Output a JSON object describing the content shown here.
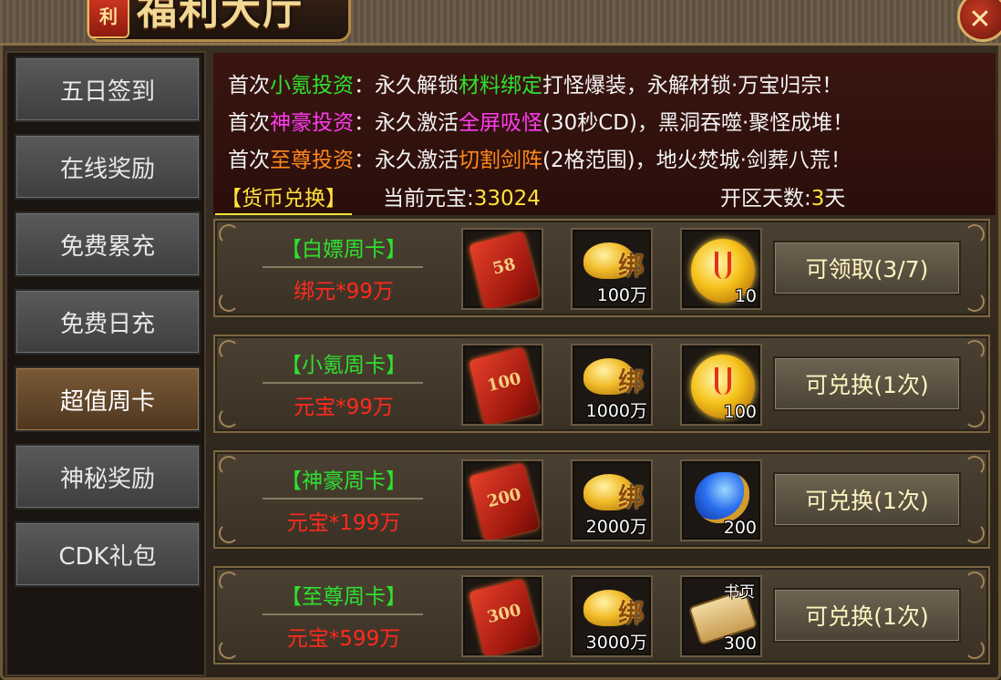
{
  "window": {
    "title": "福利大厅",
    "badge": "利",
    "close_glyph": "✕"
  },
  "sidebar": {
    "items": [
      {
        "label": "五日签到",
        "active": false
      },
      {
        "label": "在线奖励",
        "active": false
      },
      {
        "label": "免费累充",
        "active": false
      },
      {
        "label": "免费日充",
        "active": false
      },
      {
        "label": "超值周卡",
        "active": true
      },
      {
        "label": "神秘奖励",
        "active": false
      },
      {
        "label": "CDK礼包",
        "active": false
      }
    ]
  },
  "info": {
    "line1": {
      "prefix": "首次",
      "highlight": "小氪投资",
      "mid": "：永久解锁",
      "feature": "材料绑定",
      "suffix": "打怪爆装，永解材锁·万宝归宗！"
    },
    "line2": {
      "prefix": "首次",
      "highlight": "神豪投资",
      "mid": "：永久激活",
      "feature": "全屏吸怪",
      "suffix": "(30秒CD)，黑洞吞噬·聚怪成堆！"
    },
    "line3": {
      "prefix": "首次",
      "highlight": "至尊投资",
      "mid": "：永久激活",
      "feature": "切割剑阵",
      "suffix": "(2格范围)，地火焚城·剑葬八荒！"
    },
    "exchange_tab": "【货币兑换】",
    "yuanbao_label": "当前元宝:",
    "yuanbao_value": "33024",
    "days_label": "开区天数:",
    "days_value": "3",
    "days_unit": "天"
  },
  "cards": [
    {
      "name": "【白嫖周卡】",
      "price": "绑元*99万",
      "envelope": "58",
      "ingot_tag": "绑",
      "ingot_count": "100万",
      "reward_type": "coin",
      "reward_count": "10",
      "reward_tag": "",
      "button": "可领取(3/7)"
    },
    {
      "name": "【小氪周卡】",
      "price": "元宝*99万",
      "envelope": "100",
      "ingot_tag": "绑",
      "ingot_count": "1000万",
      "reward_type": "coin",
      "reward_count": "100",
      "reward_tag": "",
      "button": "可兑换(1次)"
    },
    {
      "name": "【神豪周卡】",
      "price": "元宝*199万",
      "envelope": "200",
      "ingot_tag": "绑",
      "ingot_count": "2000万",
      "reward_type": "orb",
      "reward_count": "200",
      "reward_tag": "",
      "button": "可兑换(1次)"
    },
    {
      "name": "【至尊周卡】",
      "price": "元宝*599万",
      "envelope": "300",
      "ingot_tag": "绑",
      "ingot_count": "3000万",
      "reward_type": "scroll",
      "reward_count": "300",
      "reward_tag": "书页",
      "button": "可兑换(1次)"
    }
  ],
  "colors": {
    "green": "#2fe02f",
    "magenta": "#ff3cf0",
    "orange": "#ff8a1e",
    "yellow": "#ffe23a",
    "red": "#ff2a1e"
  }
}
